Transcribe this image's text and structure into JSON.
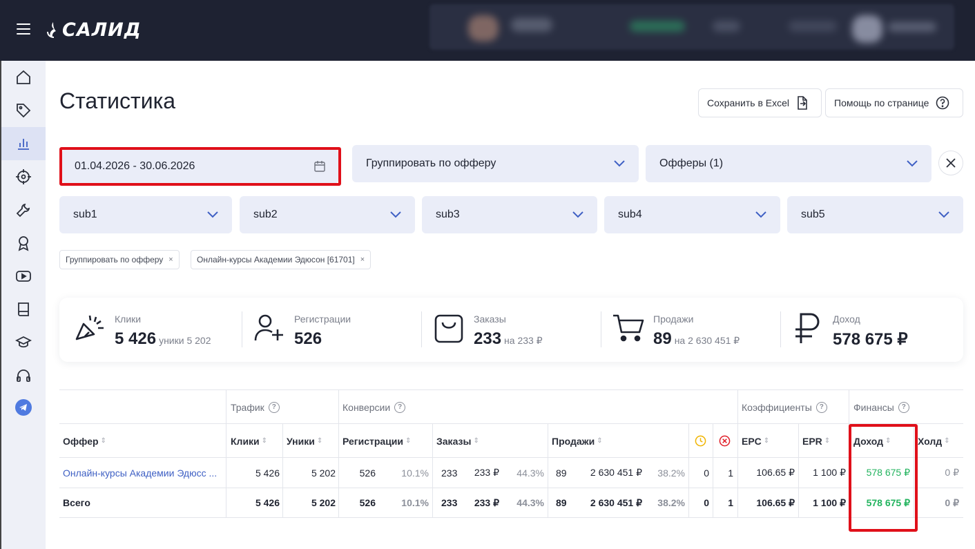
{
  "app": {
    "logo_text": "САЛИД"
  },
  "page": {
    "title": "Статистика"
  },
  "toolbar": {
    "excel_label": "Сохранить в Excel",
    "help_label": "Помощь по странице"
  },
  "filters": {
    "date_range": "01.04.2026 - 30.06.2026",
    "group_by": "Группировать по офферу",
    "offers": "Офферы (1)",
    "subs": [
      "sub1",
      "sub2",
      "sub3",
      "sub4",
      "sub5"
    ]
  },
  "chips": [
    {
      "label": "Группировать по офферу",
      "close": "×"
    },
    {
      "label": "Онлайн-курсы Академии Эдюсон [61701]",
      "close": "×"
    }
  ],
  "stats": {
    "clicks": {
      "label": "Клики",
      "value": "5 426",
      "sub": "уники 5 202"
    },
    "registrations": {
      "label": "Регистрации",
      "value": "526"
    },
    "orders": {
      "label": "Заказы",
      "value": "233",
      "sub": "на 233 ₽"
    },
    "sales": {
      "label": "Продажи",
      "value": "89",
      "sub": "на 2 630 451 ₽"
    },
    "income": {
      "label": "Доход",
      "value": "578 675 ₽"
    }
  },
  "table": {
    "groups": {
      "traffic": "Трафик",
      "conversions": "Конверсии",
      "coefficients": "Коэффициенты",
      "finance": "Финансы"
    },
    "columns": {
      "offer": "Оффер",
      "clicks": "Клики",
      "uniques": "Уники",
      "registrations": "Регистрации",
      "orders": "Заказы",
      "sales": "Продажи",
      "epc": "EPC",
      "epr": "EPR",
      "income": "Доход",
      "hold": "Холд"
    },
    "rows": [
      {
        "offer": "Онлайн-курсы Академии Эдюсс ...",
        "clicks": "5 426",
        "uniques": "5 202",
        "reg": "526",
        "reg_pct": "10.1%",
        "orders": "233",
        "orders_sum": "233 ₽",
        "orders_pct": "44.3%",
        "sales": "89",
        "sales_sum": "2 630 451 ₽",
        "sales_pct": "38.2%",
        "pending": "0",
        "rejected": "1",
        "epc": "106.65 ₽",
        "epr": "1 100 ₽",
        "income": "578 675 ₽",
        "hold": "0 ₽"
      }
    ],
    "total": {
      "label": "Всего",
      "clicks": "5 426",
      "uniques": "5 202",
      "reg": "526",
      "reg_pct": "10.1%",
      "orders": "233",
      "orders_sum": "233 ₽",
      "orders_pct": "44.3%",
      "sales": "89",
      "sales_sum": "2 630 451 ₽",
      "sales_pct": "38.2%",
      "pending": "0",
      "rejected": "1",
      "epc": "106.65 ₽",
      "epr": "1 100 ₽",
      "income": "578 675 ₽",
      "hold": "0 ₽"
    }
  },
  "colors": {
    "accent": "#3f60c4",
    "income_green": "#22b35e",
    "highlight_red": "#e0101a",
    "topbar": "#1e2232"
  }
}
